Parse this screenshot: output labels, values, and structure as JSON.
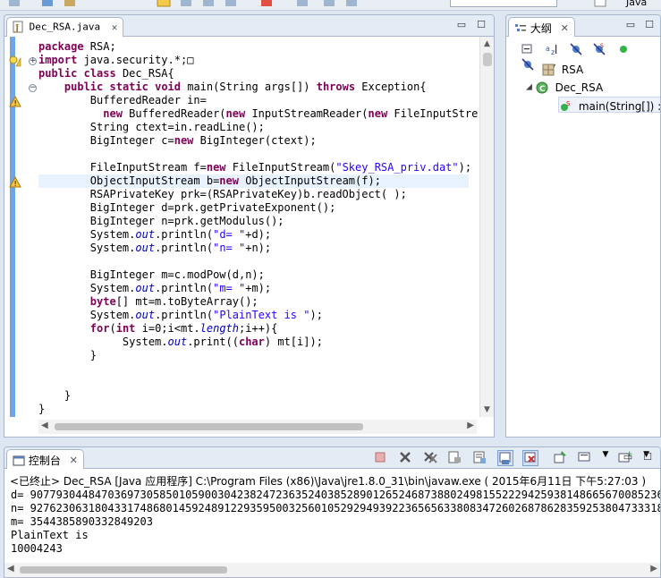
{
  "top_toolbar": {
    "perspective_label": "Java"
  },
  "editor": {
    "tab_label": "Dec_RSA.java",
    "tab_close": "✕",
    "minimize": "▭",
    "maximize": "☐",
    "lines": [
      [
        {
          "t": "package",
          "c": "kw"
        },
        {
          "t": " RSA;",
          "c": ""
        }
      ],
      [
        {
          "t": "import",
          "c": "kw"
        },
        {
          "t": " java.security.*;",
          "c": ""
        },
        {
          "t": "□",
          "c": ""
        }
      ],
      [
        {
          "t": "public",
          "c": "kw"
        },
        {
          "t": " ",
          "c": ""
        },
        {
          "t": "class",
          "c": "kw"
        },
        {
          "t": " Dec_RSA{",
          "c": ""
        }
      ],
      [
        {
          "t": "    ",
          "c": ""
        },
        {
          "t": "public",
          "c": "kw"
        },
        {
          "t": " ",
          "c": ""
        },
        {
          "t": "static",
          "c": "kw"
        },
        {
          "t": " ",
          "c": ""
        },
        {
          "t": "void",
          "c": "kw"
        },
        {
          "t": " main(String args[]) ",
          "c": ""
        },
        {
          "t": "throws",
          "c": "kw"
        },
        {
          "t": " Exception{",
          "c": ""
        }
      ],
      [
        {
          "t": "        BufferedReader in=",
          "c": ""
        }
      ],
      [
        {
          "t": "          ",
          "c": ""
        },
        {
          "t": "new",
          "c": "kw"
        },
        {
          "t": " BufferedReader(",
          "c": ""
        },
        {
          "t": "new",
          "c": "kw"
        },
        {
          "t": " InputStreamReader(",
          "c": ""
        },
        {
          "t": "new",
          "c": "kw"
        },
        {
          "t": " FileInputStre",
          "c": ""
        }
      ],
      [
        {
          "t": "        String ctext=in.readLine();",
          "c": ""
        }
      ],
      [
        {
          "t": "        BigInteger c=",
          "c": ""
        },
        {
          "t": "new",
          "c": "kw"
        },
        {
          "t": " BigInteger(ctext);",
          "c": ""
        }
      ],
      [
        {
          "t": "",
          "c": ""
        }
      ],
      [
        {
          "t": "        FileInputStream f=",
          "c": ""
        },
        {
          "t": "new",
          "c": "kw"
        },
        {
          "t": " FileInputStream(",
          "c": ""
        },
        {
          "t": "\"Skey_RSA_priv.dat\"",
          "c": "str"
        },
        {
          "t": ");",
          "c": ""
        }
      ],
      [
        {
          "t": "        ObjectInputStream b=",
          "c": ""
        },
        {
          "t": "new",
          "c": "kw"
        },
        {
          "t": " ObjectInputStream(f);",
          "c": ""
        }
      ],
      [
        {
          "t": "        RSAPrivateKey prk=(RSAPrivateKey)b.readObject( );",
          "c": ""
        }
      ],
      [
        {
          "t": "        BigInteger d=prk.getPrivateExponent();",
          "c": ""
        }
      ],
      [
        {
          "t": "        BigInteger n=prk.getModulus();",
          "c": ""
        }
      ],
      [
        {
          "t": "        System.",
          "c": ""
        },
        {
          "t": "out",
          "c": "fld"
        },
        {
          "t": ".println(",
          "c": ""
        },
        {
          "t": "\"d= \"",
          "c": "str"
        },
        {
          "t": "+d);",
          "c": ""
        }
      ],
      [
        {
          "t": "        System.",
          "c": ""
        },
        {
          "t": "out",
          "c": "fld"
        },
        {
          "t": ".println(",
          "c": ""
        },
        {
          "t": "\"n= \"",
          "c": "str"
        },
        {
          "t": "+n);",
          "c": ""
        }
      ],
      [
        {
          "t": "",
          "c": ""
        }
      ],
      [
        {
          "t": "        BigInteger m=c.modPow(d,n);",
          "c": ""
        }
      ],
      [
        {
          "t": "        System.",
          "c": ""
        },
        {
          "t": "out",
          "c": "fld"
        },
        {
          "t": ".println(",
          "c": ""
        },
        {
          "t": "\"m= \"",
          "c": "str"
        },
        {
          "t": "+m);",
          "c": ""
        }
      ],
      [
        {
          "t": "        ",
          "c": ""
        },
        {
          "t": "byte",
          "c": "kw"
        },
        {
          "t": "[] mt=m.toByteArray();",
          "c": ""
        }
      ],
      [
        {
          "t": "        System.",
          "c": ""
        },
        {
          "t": "out",
          "c": "fld"
        },
        {
          "t": ".println(",
          "c": ""
        },
        {
          "t": "\"PlainText is \"",
          "c": "str"
        },
        {
          "t": ");",
          "c": ""
        }
      ],
      [
        {
          "t": "        ",
          "c": ""
        },
        {
          "t": "for",
          "c": "kw"
        },
        {
          "t": "(",
          "c": ""
        },
        {
          "t": "int",
          "c": "kw"
        },
        {
          "t": " i=0;i<mt.",
          "c": ""
        },
        {
          "t": "length",
          "c": "fld"
        },
        {
          "t": ";i++){",
          "c": ""
        }
      ],
      [
        {
          "t": "             System.",
          "c": ""
        },
        {
          "t": "out",
          "c": "fld"
        },
        {
          "t": ".print((",
          "c": ""
        },
        {
          "t": "char",
          "c": "kw"
        },
        {
          "t": ") mt[i]);",
          "c": ""
        }
      ],
      [
        {
          "t": "        }",
          "c": ""
        }
      ],
      [
        {
          "t": "",
          "c": ""
        }
      ],
      [
        {
          "t": "",
          "c": ""
        }
      ],
      [
        {
          "t": "    }",
          "c": ""
        }
      ],
      [
        {
          "t": "}",
          "c": ""
        }
      ]
    ],
    "highlighted_line": 10
  },
  "outline": {
    "tab_label": "大纲",
    "tab_close": "✕",
    "minimize": "▭",
    "maximize": "☐",
    "items": [
      {
        "label": "RSA",
        "icon": "import-declarations-icon"
      },
      {
        "label": "Dec_RSA",
        "icon": "class-icon"
      },
      {
        "label": "main(String[]) :",
        "icon": "static-method-icon"
      }
    ]
  },
  "console": {
    "tab_label": "控制台",
    "tab_close": "✕",
    "minimize": "▭",
    "maximize": "☐",
    "terminated_line": "<已终止> Dec_RSA [Java 应用程序] C:\\Program Files (x86)\\Java\\jre1.8.0_31\\bin\\javaw.exe ( 2015年6月11日 下午5:27:03 )",
    "output_lines": [
      "d= 90779304484703697305850105900304238247236352403852890126524687388024981552229425938148665670085236l",
      "n= 92762306318043317486801459248912293595003256010529294939223656563380834726026878628359253804733318€",
      "m= 3544385890332849203",
      "PlainText is",
      "10004243"
    ]
  },
  "colors": {
    "keyword": "#7f0055",
    "string": "#2a00ff",
    "field": "#0000c0",
    "fold_bar": "#6ea6e5",
    "line_highlight": "#e8f2fe"
  }
}
